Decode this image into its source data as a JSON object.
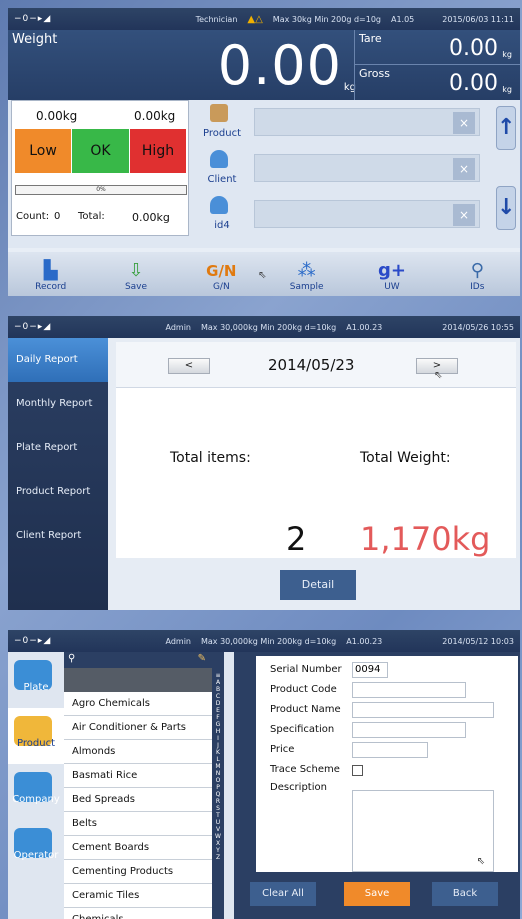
{
  "s1": {
    "status": {
      "icons": "−0−▸◢",
      "user": "Technician",
      "warn": "▲△",
      "capacity": "Max 30kg  Min 200g  d=10g",
      "version": "A1.05",
      "datetime": "2015/06/03  11:11"
    },
    "weight_label": "Weight",
    "weight_value": "0.00",
    "weight_unit": "kg",
    "tare_label": "Tare",
    "tare_value": "0.00",
    "tare_unit": "kg",
    "gross_label": "Gross",
    "gross_value": "0.00",
    "gross_unit": "kg",
    "low_weight": "0.00kg",
    "high_weight": "0.00kg",
    "low_label": "Low",
    "ok_label": "OK",
    "high_label": "High",
    "progress_text": "0%",
    "progress": 0,
    "count_label": "Count:",
    "count_value": "0",
    "total_label": "Total:",
    "total_value": "0.00kg",
    "fields": [
      {
        "label": "Product",
        "icon": "product-icon",
        "clear": "×"
      },
      {
        "label": "Client",
        "icon": "client-icon",
        "clear": "×"
      },
      {
        "label": "id4",
        "icon": "id-icon",
        "clear": "×"
      }
    ],
    "scroll_up": "↑",
    "scroll_down": "↓",
    "toolbar": [
      {
        "label": "Record",
        "icon": "▙"
      },
      {
        "label": "Save",
        "icon": "⇩"
      },
      {
        "label": "G/N",
        "icon": "G/N"
      },
      {
        "label": "Sample",
        "icon": "⁂"
      },
      {
        "label": "UW",
        "icon": "g+"
      },
      {
        "label": "IDs",
        "icon": "⚲"
      }
    ],
    "colors": {
      "low": "#f08a2a",
      "ok": "#38b848",
      "high": "#e03030"
    }
  },
  "s2": {
    "status": {
      "icons": "−0−▸◢",
      "user": "Admin",
      "capacity": "Max 30,000kg  Min 200kg  d=10kg",
      "version": "A1.00.23",
      "datetime": "2014/05/26  10:55"
    },
    "menu": [
      "Daily Report",
      "Monthly Report",
      "Plate Report",
      "Product Report",
      "Client Report"
    ],
    "prev": "<",
    "next": ">",
    "date": "2014/05/23",
    "total_items_label": "Total items:",
    "total_weight_label": "Total Weight:",
    "total_items": "2",
    "total_weight": "1,170kg",
    "detail_button": "Detail"
  },
  "s3": {
    "status": {
      "icons": "−0−▸◢",
      "user": "Admin",
      "capacity": "Max 30,000kg  Min 200kg  d=10kg",
      "version": "A1.00.23",
      "datetime": "2014/05/12  10:03"
    },
    "categories": [
      "Plate",
      "Product",
      "Company",
      "Operator"
    ],
    "list": [
      "Agro Chemicals",
      "Air Conditioner & Parts",
      "Almonds",
      "Basmati Rice",
      "Bed Spreads",
      "Belts",
      "Cement Boards",
      "Cementing Products",
      "Ceramic Tiles",
      "Chemicals"
    ],
    "alphabet": "≡\nA\nB\nC\nD\nE\nF\nG\nH\nI\nJ\nK\nL\nM\nN\nO\nP\nQ\nR\nS\nT\nU\nV\nW\nX\nY\nZ",
    "form": {
      "serial_label": "Serial Number",
      "serial_value": "0094",
      "code_label": "Product Code",
      "name_label": "Product Name",
      "spec_label": "Specification",
      "price_label": "Price",
      "trace_label": "Trace Scheme",
      "desc_label": "Description"
    },
    "clear_all": "Clear All",
    "save": "Save",
    "back": "Back"
  }
}
